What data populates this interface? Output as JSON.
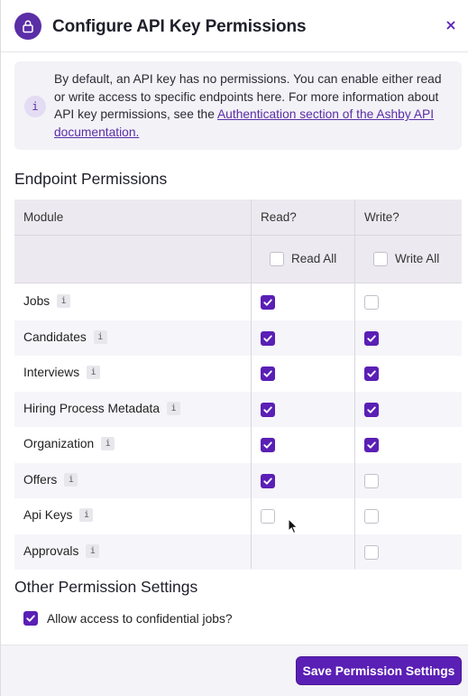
{
  "modal": {
    "title": "Configure API Key Permissions",
    "close_label": "×",
    "icons": {
      "header": "lock-icon",
      "notice": "info-icon"
    },
    "accent_color": "#5a1fb5"
  },
  "notice": {
    "icon_glyph": "i",
    "text_before": "By default, an API key has no permissions. You can enable either read or write access to specific endpoints here. For more information about API key permissions, see the ",
    "link_text": "Authentication section of the Ashby API documentation."
  },
  "endpoint_section": {
    "title": "Endpoint Permissions",
    "columns": {
      "module": "Module",
      "read": "Read?",
      "write": "Write?"
    },
    "read_all_label": "Read All",
    "write_all_label": "Write All",
    "read_all_checked": false,
    "write_all_checked": false,
    "info_glyph": "i",
    "rows": [
      {
        "module": "Jobs",
        "read": true,
        "write": false,
        "read_available": true
      },
      {
        "module": "Candidates",
        "read": true,
        "write": true,
        "read_available": true
      },
      {
        "module": "Interviews",
        "read": true,
        "write": true,
        "read_available": true
      },
      {
        "module": "Hiring Process Metadata",
        "read": true,
        "write": true,
        "read_available": true
      },
      {
        "module": "Organization",
        "read": true,
        "write": true,
        "read_available": true
      },
      {
        "module": "Offers",
        "read": true,
        "write": false,
        "read_available": true
      },
      {
        "module": "Api Keys",
        "read": false,
        "write": false,
        "read_available": true
      },
      {
        "module": "Approvals",
        "read": false,
        "write": false,
        "read_available": false
      }
    ]
  },
  "other_section": {
    "title": "Other Permission Settings",
    "confidential_label": "Allow access to confidential jobs?",
    "confidential_checked": true
  },
  "footer": {
    "save_label": "Save Permission Settings"
  }
}
